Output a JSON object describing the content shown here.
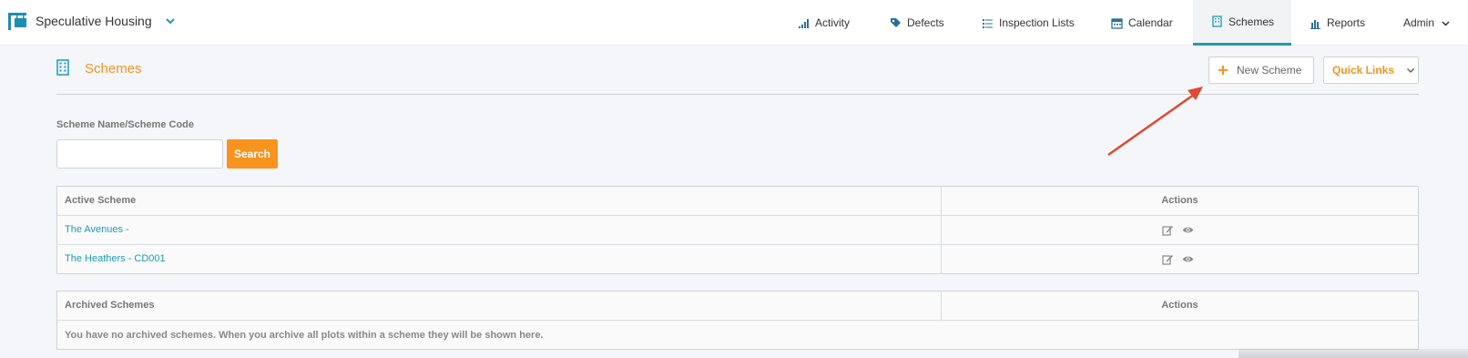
{
  "app": {
    "name": "Speculative Housing"
  },
  "nav": {
    "items": [
      {
        "label": "Activity",
        "icon": "bar-signal-icon"
      },
      {
        "label": "Defects",
        "icon": "tag-icon"
      },
      {
        "label": "Inspection Lists",
        "icon": "list-icon"
      },
      {
        "label": "Calendar",
        "icon": "calendar-icon"
      },
      {
        "label": "Schemes",
        "icon": "building-icon",
        "active": true
      },
      {
        "label": "Reports",
        "icon": "bar-chart-icon"
      }
    ],
    "user": "Admin"
  },
  "page": {
    "title": "Schemes",
    "new_button": "New Scheme",
    "quick_links": "Quick Links"
  },
  "search": {
    "label": "Scheme Name/Scheme Code",
    "value": "",
    "button": "Search"
  },
  "active_table": {
    "headers": [
      "Active Scheme",
      "Actions"
    ],
    "rows": [
      {
        "name": "The Avenues -",
        "actions": [
          "edit-icon",
          "view-icon"
        ]
      },
      {
        "name": "The Heathers - CD001",
        "actions": [
          "edit-icon",
          "view-icon"
        ]
      }
    ]
  },
  "archived_table": {
    "headers": [
      "Archived Schemes",
      "Actions"
    ],
    "empty_message": "You have no archived schemes. When you archive all plots within a scheme they will be shown here."
  },
  "colors": {
    "accent": "#1a9bb5",
    "orange": "#f7931e",
    "annotation_arrow": "#e0492f"
  }
}
